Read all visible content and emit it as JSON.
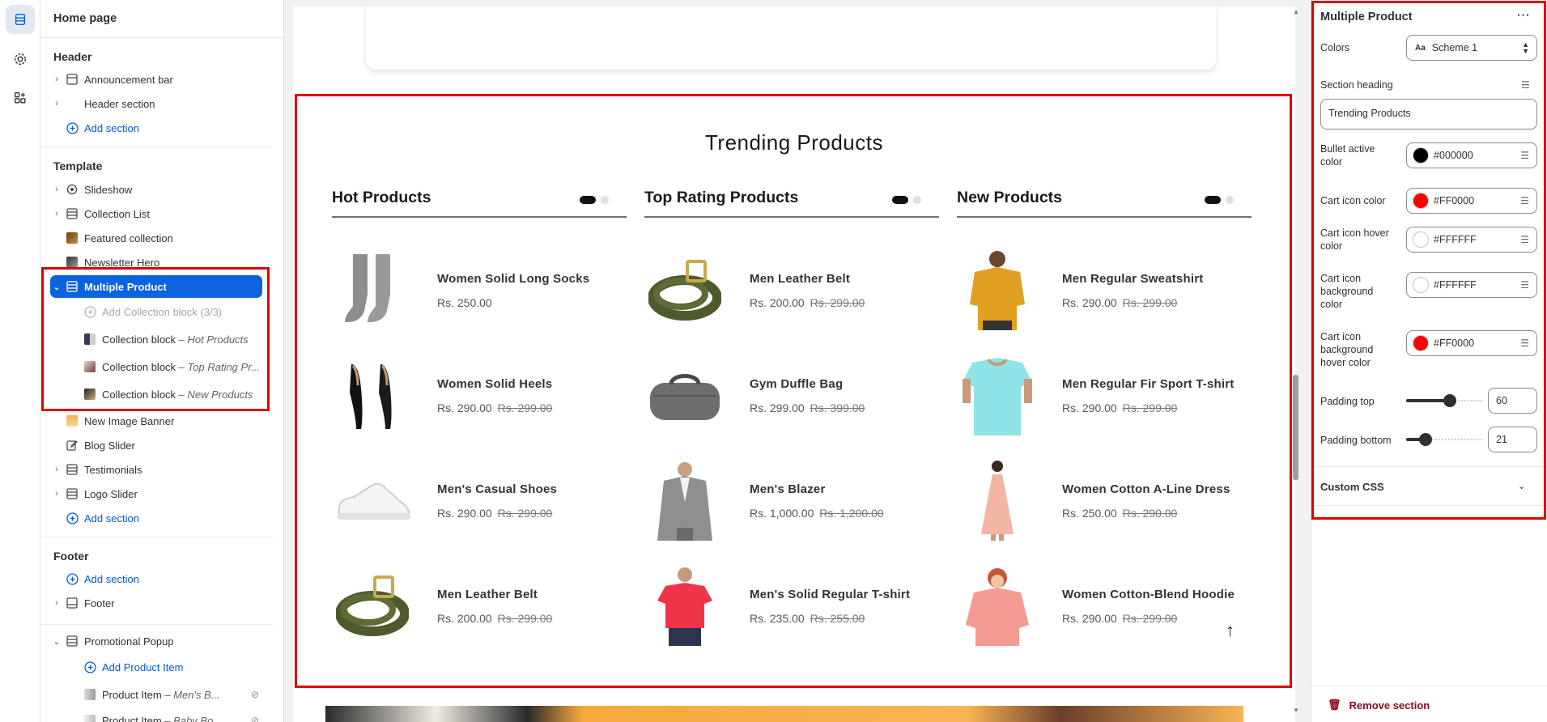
{
  "sidebar": {
    "title": "Home page",
    "header_group": "Header",
    "template_group": "Template",
    "footer_group": "Footer",
    "header_items": [
      {
        "label": "Announcement bar"
      },
      {
        "label": "Header section"
      }
    ],
    "add_section": "Add section",
    "template_items": [
      {
        "label": "Slideshow"
      },
      {
        "label": "Collection List"
      },
      {
        "label": "Featured collection"
      },
      {
        "label": "Newsletter Hero"
      },
      {
        "label": "Multiple Product"
      }
    ],
    "multiple_product_children": {
      "add_block": "Add Collection block (3/3)",
      "blocks": [
        {
          "label": "Collection block",
          "suffix": "– Hot Products"
        },
        {
          "label": "Collection block",
          "suffix": "– Top Rating Pr..."
        },
        {
          "label": "Collection block",
          "suffix": "– New Products"
        }
      ]
    },
    "template_items_after": [
      {
        "label": "New Image Banner"
      },
      {
        "label": "Blog Slider"
      },
      {
        "label": "Testimonials"
      },
      {
        "label": "Logo Slider"
      }
    ],
    "footer_items": [
      {
        "label": "Footer"
      },
      {
        "label": "Promotional Popup"
      }
    ],
    "popup_children": {
      "add_item": "Add Product Item",
      "items": [
        {
          "label": "Product Item",
          "suffix": "– Men's B..."
        },
        {
          "label": "Product Item",
          "suffix": "– Baby Bo..."
        }
      ]
    }
  },
  "preview": {
    "section_heading": "Trending Products",
    "columns": [
      {
        "title": "Hot Products",
        "products": [
          {
            "name": "Women Solid Long Socks",
            "price": "Rs. 250.00",
            "compare": "",
            "icon": "socks"
          },
          {
            "name": "Women Solid Heels",
            "price": "Rs. 290.00",
            "compare": "Rs. 299.00",
            "icon": "heels"
          },
          {
            "name": "Men's Casual Shoes",
            "price": "Rs. 290.00",
            "compare": "Rs. 299.00",
            "icon": "sneaker"
          },
          {
            "name": "Men Leather Belt",
            "price": "Rs. 200.00",
            "compare": "Rs. 299.00",
            "icon": "belt"
          }
        ]
      },
      {
        "title": "Top Rating Products",
        "products": [
          {
            "name": "Men Leather Belt",
            "price": "Rs. 200.00",
            "compare": "Rs. 299.00",
            "icon": "belt"
          },
          {
            "name": "Gym Duffle Bag",
            "price": "Rs. 299.00",
            "compare": "Rs. 399.00",
            "icon": "bag"
          },
          {
            "name": "Men's Blazer",
            "price": "Rs. 1,000.00",
            "compare": "Rs. 1,200.00",
            "icon": "blazer"
          },
          {
            "name": "Men's Solid Regular T-shirt",
            "price": "Rs. 235.00",
            "compare": "Rs. 255.00",
            "icon": "tshirt-red"
          }
        ]
      },
      {
        "title": "New Products",
        "products": [
          {
            "name": "Men Regular Sweatshirt",
            "price": "Rs. 290.00",
            "compare": "Rs. 299.00",
            "icon": "sweatshirt"
          },
          {
            "name": "Men Regular Fir Sport T-shirt",
            "price": "Rs. 290.00",
            "compare": "Rs. 299.00",
            "icon": "tshirt-blue"
          },
          {
            "name": "Women Cotton A-Line Dress",
            "price": "Rs. 250.00",
            "compare": "Rs. 290.00",
            "icon": "dress"
          },
          {
            "name": "Women Cotton-Blend Hoodie",
            "price": "Rs. 290.00",
            "compare": "Rs. 299.00",
            "icon": "hoodie"
          }
        ]
      }
    ],
    "back_to_top": "↑"
  },
  "panel": {
    "title": "Multiple Product",
    "more": "⋯",
    "colors_label": "Colors",
    "scheme_icon": "Aa",
    "scheme_value": "Scheme 1",
    "section_heading_label": "Section heading",
    "section_heading_value": "Trending Products",
    "bullet_label": "Bullet active color",
    "bullet_value": "#000000",
    "cart_icon_label": "Cart icon color",
    "cart_icon_value": "#FF0000",
    "cart_hover_label": "Cart icon hover color",
    "cart_hover_value": "#FFFFFF",
    "cart_bg_label": "Cart icon background color",
    "cart_bg_value": "#FFFFFF",
    "cart_bg_hover_label": "Cart icon background hover color",
    "cart_bg_hover_value": "#FF0000",
    "padding_top_label": "Padding top",
    "padding_top_value": "60",
    "padding_bottom_label": "Padding bottom",
    "padding_bottom_value": "21",
    "custom_css_label": "Custom CSS",
    "remove_label": "Remove section"
  },
  "colors": {
    "accent": "#0b63de",
    "highlight": "#e00000",
    "danger": "#8e0b21"
  }
}
